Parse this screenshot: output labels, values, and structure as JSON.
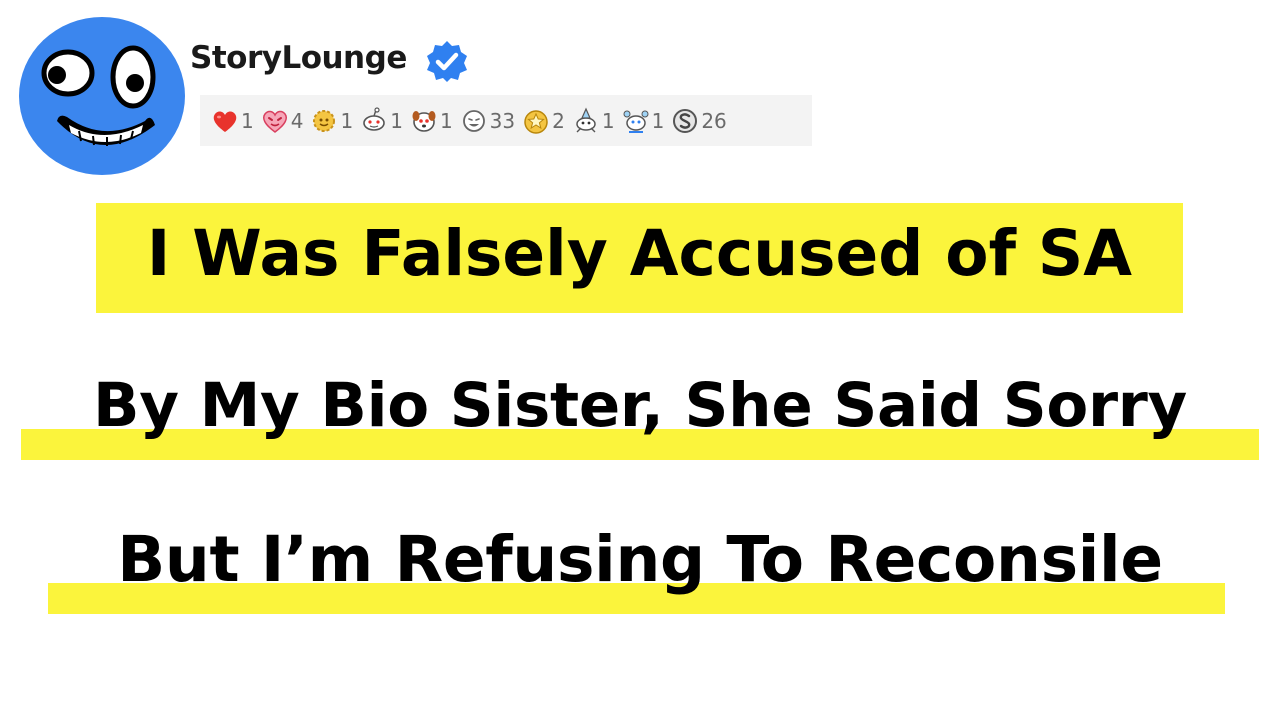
{
  "channel": {
    "name": "StoryLounge",
    "avatar_icon": "smiling-face-icon",
    "verified_icon": "verified-badge-icon",
    "colors": {
      "avatar": "#3b86ee",
      "verified": "#2f80f0"
    }
  },
  "awards": [
    {
      "icon": "heart-award-icon",
      "count": "1"
    },
    {
      "icon": "heart-eyes-award-icon",
      "count": "4"
    },
    {
      "icon": "sun-award-icon",
      "count": "1"
    },
    {
      "icon": "snoo-award-icon",
      "count": "1"
    },
    {
      "icon": "puppy-award-icon",
      "count": "1"
    },
    {
      "icon": "laugh-award-icon",
      "count": "33"
    },
    {
      "icon": "star-award-icon",
      "count": "2"
    },
    {
      "icon": "party-snoo-award-icon",
      "count": "1"
    },
    {
      "icon": "cheer-snoo-award-icon",
      "count": "1"
    },
    {
      "icon": "silver-award-icon",
      "count": "26"
    }
  ],
  "headline": {
    "line1": "I Was Falsely Accused of SA",
    "line2": "By My Bio Sister, She Said Sorry",
    "line3": "But I’m Refusing To Reconsile",
    "highlight_color": "#fbf43c"
  }
}
